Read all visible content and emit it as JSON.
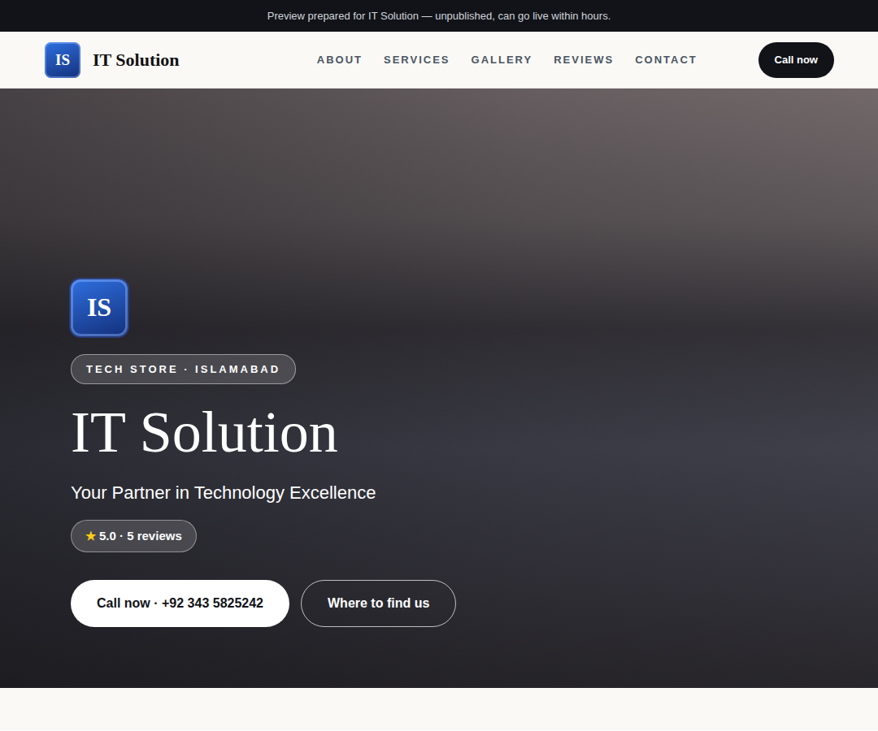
{
  "banner": "Preview prepared for IT Solution — unpublished, can go live within hours.",
  "brand": {
    "initials": "IS",
    "name": "IT Solution"
  },
  "nav": {
    "links": [
      "ABOUT",
      "SERVICES",
      "GALLERY",
      "REVIEWS",
      "CONTACT"
    ],
    "cta": "Call now"
  },
  "hero": {
    "initials": "IS",
    "tag": "TECH STORE · ISLAMABAD",
    "title": "IT Solution",
    "subtitle": "Your Partner in Technology Excellence",
    "rating": {
      "star": "★",
      "text": "5.0 · 5 reviews"
    },
    "buttons": [
      {
        "label": "Call now · +92 343 5825242",
        "kind": "primary"
      },
      {
        "label": "Where to find us",
        "kind": "outline"
      }
    ]
  }
}
